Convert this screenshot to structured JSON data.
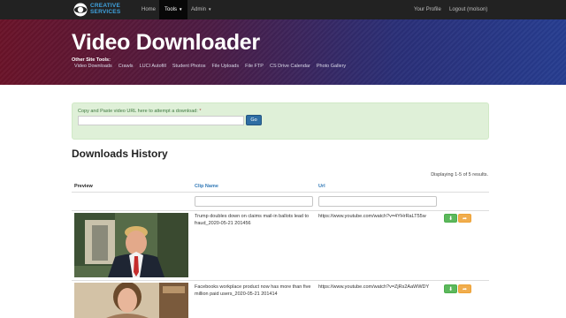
{
  "navbar": {
    "brand_line1": "CREATIVE",
    "brand_line2": "SERVICES",
    "items": [
      {
        "label": "Home"
      },
      {
        "label": "Tools"
      },
      {
        "label": "Admin"
      }
    ],
    "right": [
      {
        "label": "Your Profile"
      },
      {
        "label": "Logout (molson)"
      }
    ]
  },
  "hero": {
    "title": "Video Downloader",
    "subtitle": "Other Site Tools:",
    "links": [
      "Video Downloads",
      "Crawls",
      "LUCI Autofill",
      "Student Photos",
      "File Uploads",
      "File FTP",
      "CS Drive Calendar",
      "Photo Gallery"
    ]
  },
  "alert": {
    "label": "Copy and Paste video URL here to attempt a download:",
    "required_mark": "*",
    "input_value": "",
    "go_label": "Go"
  },
  "downloads": {
    "title": "Downloads History",
    "summary": "Displaying 1-5 of 5 results.",
    "columns": [
      "Preview",
      "Clip Name",
      "Url"
    ],
    "rows": [
      {
        "clip_name": "Trump doubles down on claims mail-in ballots lead to fraud_2020-05-21 201456",
        "url": "https://www.youtube.com/watch?v=4YHrRaLT55w"
      },
      {
        "clip_name": "Facebooks workplace product now has more than five million paid users_2020-05-21 201414",
        "url": "https://www.youtube.com/watch?v=ZjRs2AaWWDY"
      }
    ]
  },
  "icons": {
    "download": "download-icon",
    "export": "share-icon"
  },
  "colors": {
    "navbar": "#222222",
    "hero_left": "#6a1328",
    "hero_right": "#263d90",
    "alert_bg": "#dff0d8",
    "primary": "#337ab7",
    "success": "#5cb85c",
    "warning": "#f0ad4e"
  }
}
